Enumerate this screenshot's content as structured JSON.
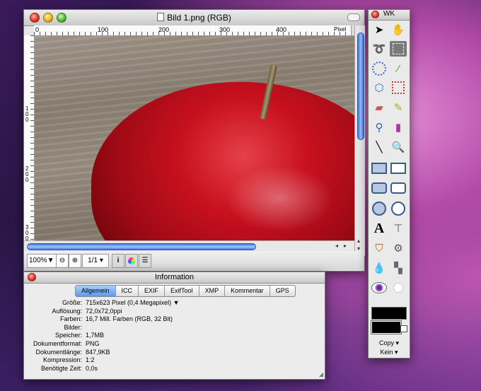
{
  "image_window": {
    "title": "Bild 1.png (RGB)",
    "ruler_top_ticks": [
      "0",
      "100",
      "200",
      "300",
      "400"
    ],
    "ruler_unit": "Pixel",
    "ruler_left_ticks": [
      "100",
      "200",
      "300"
    ],
    "zoom": "100%",
    "page": "1/1",
    "scroll_left": "◂",
    "scroll_right": "▸",
    "scroll_up": "▴",
    "scroll_down": "▾"
  },
  "info_window": {
    "title": "Information",
    "tabs": [
      {
        "label": "Allgemein",
        "active": true
      },
      {
        "label": "ICC",
        "active": false
      },
      {
        "label": "EXIF",
        "active": false
      },
      {
        "label": "ExifTool",
        "active": false
      },
      {
        "label": "XMP",
        "active": false
      },
      {
        "label": "Kommentar",
        "active": false
      },
      {
        "label": "GPS",
        "active": false
      }
    ],
    "rows": [
      {
        "key": "Größe:",
        "value": "715x623 Pixel (0,4 Megapixel) ▼"
      },
      {
        "key": "Auflösung:",
        "value": "72,0x72,0ppi"
      },
      {
        "key": "Farben:",
        "value": "16,7 Mill. Farben (RGB, 32 Bit)"
      },
      {
        "key": "Bilder:",
        "value": ""
      },
      {
        "key": "Speicher:",
        "value": "1,7MB"
      },
      {
        "key": "Dokumentformat:",
        "value": "PNG"
      },
      {
        "key": "Dokumentlänge:",
        "value": "847,9KB"
      },
      {
        "key": "Kompression:",
        "value": "1:2"
      },
      {
        "key": "Benötigte Zeit:",
        "value": "0,0s"
      }
    ]
  },
  "tools_palette": {
    "title": "WK",
    "copy_label": "Copy",
    "mode_label": "Kein",
    "colors": {
      "foreground": "#000000",
      "background": "#000000"
    }
  }
}
